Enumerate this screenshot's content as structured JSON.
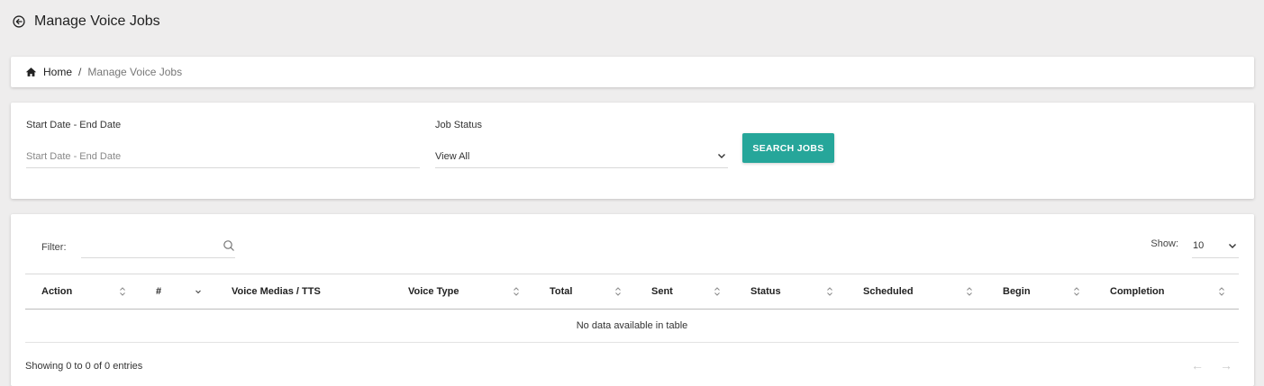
{
  "header": {
    "title": "Manage Voice Jobs",
    "back_icon": "back-arrow-circle-icon"
  },
  "breadcrumb": {
    "home": "Home",
    "separator": "/",
    "current": "Manage Voice Jobs"
  },
  "search": {
    "date_label": "Start Date - End Date",
    "date_placeholder": "Start Date - End Date",
    "status_label": "Job Status",
    "status_value": "View All",
    "button_label": "SEARCH JOBS",
    "button_color": "#26a69a"
  },
  "table": {
    "filter_label": "Filter:",
    "filter_value": "",
    "show_label": "Show:",
    "show_value": "10",
    "columns": [
      "Action",
      "#",
      "Voice Medias / TTS",
      "Voice Type",
      "Total",
      "Sent",
      "Status",
      "Scheduled",
      "Begin",
      "Completion"
    ],
    "empty_message": "No data available in table",
    "info": "Showing 0 to 0 of 0 entries",
    "prev": "←",
    "next": "→"
  }
}
